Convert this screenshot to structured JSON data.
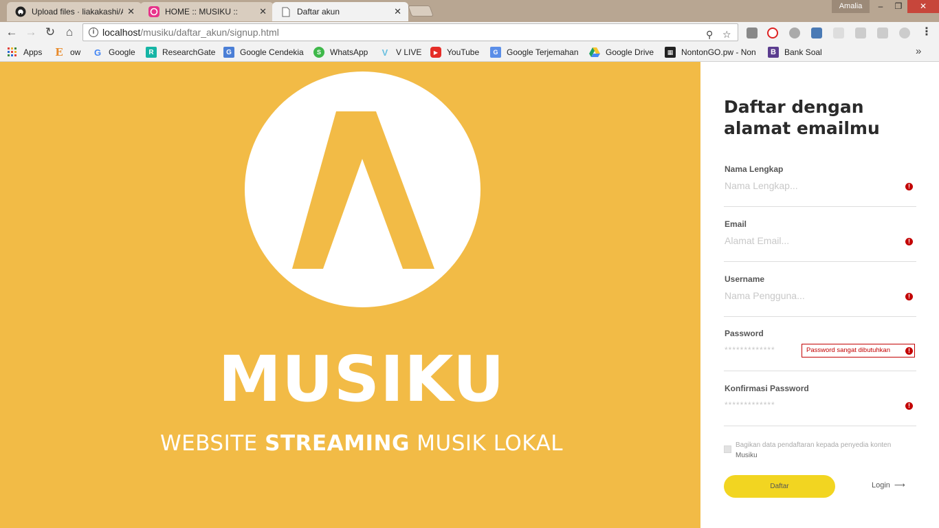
{
  "browser": {
    "tabs": [
      {
        "title": "Upload files · liakakashi/A",
        "icon": "github-icon"
      },
      {
        "title": "HOME :: MUSIKU ::",
        "icon": "musiku-icon"
      },
      {
        "title": "Daftar akun",
        "icon": "page-icon"
      }
    ],
    "profile_name": "Amalia",
    "url_host": "localhost",
    "url_path": "/musiku/daftar_akun/signup.html",
    "bookmarks": [
      {
        "label": "Apps",
        "icon": "apps-grid-icon"
      },
      {
        "label": "ow",
        "icon": "e-icon"
      },
      {
        "label": "Google",
        "icon": "google-icon"
      },
      {
        "label": "ResearchGate",
        "icon": "researchgate-icon"
      },
      {
        "label": "Google Cendekia",
        "icon": "scholar-icon"
      },
      {
        "label": "WhatsApp",
        "icon": "whatsapp-icon"
      },
      {
        "label": "V LIVE",
        "icon": "vlive-icon"
      },
      {
        "label": "YouTube",
        "icon": "youtube-icon"
      },
      {
        "label": "Google Terjemahan",
        "icon": "translate-icon"
      },
      {
        "label": "Google Drive",
        "icon": "drive-icon"
      },
      {
        "label": "NontonGO.pw - Non",
        "icon": "film-icon"
      },
      {
        "label": "Bank Soal",
        "icon": "b-icon"
      }
    ]
  },
  "hero": {
    "brand": "MUSIKU",
    "tagline_pre": "WEBSITE ",
    "tagline_bold": "STREAMING",
    "tagline_post": " MUSIK LOKAL",
    "color": "#f2bb46"
  },
  "form": {
    "heading": "Daftar dengan alamat emailmu",
    "fields": [
      {
        "label": "Nama Lengkap",
        "placeholder": "Nama Lengkap..."
      },
      {
        "label": "Email",
        "placeholder": "Alamat Email..."
      },
      {
        "label": "Username",
        "placeholder": "Nama Pengguna..."
      },
      {
        "label": "Password",
        "value": "*************",
        "error": "Password sangat dibutuhkan"
      },
      {
        "label": "Konfirmasi Password",
        "value": "*************"
      }
    ],
    "agree_text": "Bagikan data pendaftaran kepada penyedia konten",
    "agree_brand": "Musiku",
    "submit_label": "Daftar",
    "login_label": "Login",
    "error_icon_text": "!",
    "error_color": "#c30000",
    "button_color": "#f2d521"
  }
}
